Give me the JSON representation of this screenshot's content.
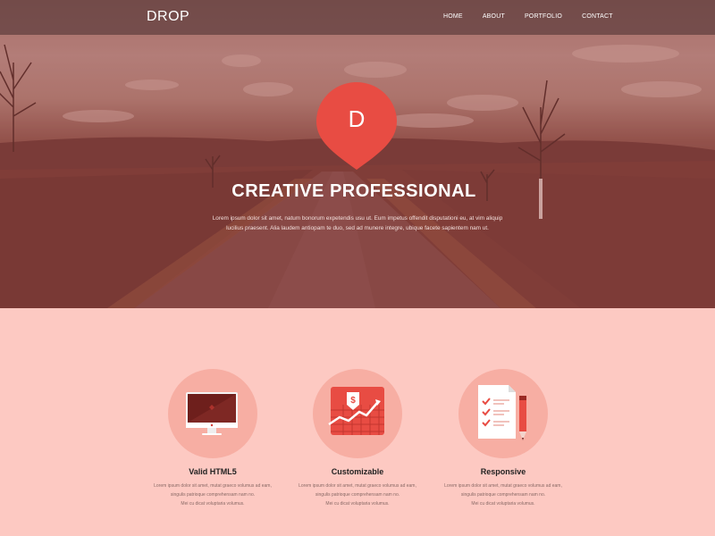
{
  "nav": {
    "brand": "DROP",
    "links": [
      "HOME",
      "ABOUT",
      "PORTFOLIO",
      "CONTACT"
    ]
  },
  "hero": {
    "pin_letter": "D",
    "title": "CREATIVE PROFESSIONAL",
    "text": "Lorem ipsum dolor sit amet, natum bonorum expetendis usu ut. Eum impetus offendit disputationi eu, at vim aliquip lucilius praesent. Alia laudem antiopam te duo, sed ad munere integre, ubique facete sapientem nam ut."
  },
  "features": [
    {
      "icon": "monitor-icon",
      "title": "Valid HTML5",
      "line1": "Lorem ipsum dolor sit amet, mutat graeco volumus ad eam,",
      "line2": "singulis patrioque comprehensam nam no.",
      "line3": "Mei cu dicat voluptaria volumus."
    },
    {
      "icon": "chart-icon",
      "title": "Customizable",
      "line1": "Lorem ipsum dolor sit amet, mutat graeco volumus ad eam,",
      "line2": "singulis patrioque comprehensam nam no.",
      "line3": "Mei cu dicat voluptaria volumus."
    },
    {
      "icon": "checklist-icon",
      "title": "Responsive",
      "line1": "Lorem ipsum dolor sit amet, mutat graeco volumus ad eam,",
      "line2": "singulis patrioque comprehensam nam no.",
      "line3": "Mei cu dicat voluptaria volumus."
    }
  ],
  "colors": {
    "accent": "#e84c43",
    "features_background": "#fdc9c2",
    "feature_circle": "#f7aea3"
  }
}
